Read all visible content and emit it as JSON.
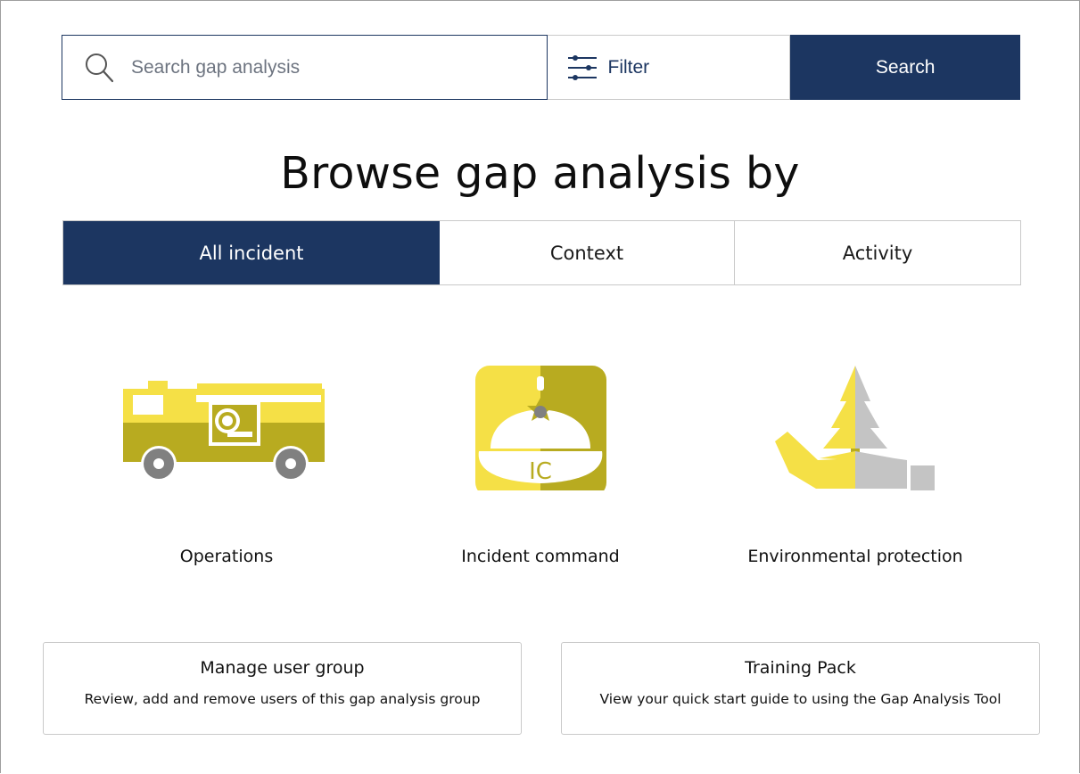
{
  "search": {
    "placeholder": "Search gap analysis",
    "filter_label": "Filter",
    "button_label": "Search"
  },
  "heading": "Browse gap analysis by",
  "tabs": [
    {
      "label": "All incident",
      "active": true
    },
    {
      "label": "Context",
      "active": false
    },
    {
      "label": "Activity",
      "active": false
    }
  ],
  "categories": [
    {
      "label": "Operations",
      "icon": "fire-truck-icon"
    },
    {
      "label": "Incident command",
      "icon": "incident-commander-helmet-icon",
      "icon_text": "IC"
    },
    {
      "label": "Environmental protection",
      "icon": "hand-tree-icon"
    }
  ],
  "cards": [
    {
      "title": "Manage user group",
      "description": "Review, add and remove users of this gap analysis group"
    },
    {
      "title": "Training Pack",
      "description": "View your quick start guide to using the Gap Analysis Tool"
    }
  ],
  "colors": {
    "primary": "#1c3661",
    "icon_yellow_light": "#f5e046",
    "icon_yellow_dark": "#b8ab20",
    "icon_gray": "#c4c4c4"
  }
}
